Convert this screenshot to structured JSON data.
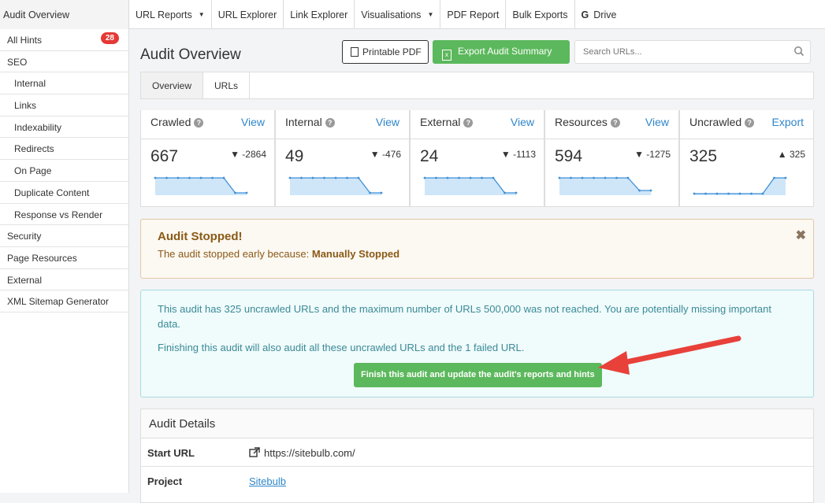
{
  "header": {
    "title": "Audit Overview",
    "menu": [
      {
        "label": "URL Reports",
        "dropdown": true
      },
      {
        "label": "URL Explorer",
        "dropdown": false
      },
      {
        "label": "Link Explorer",
        "dropdown": false
      },
      {
        "label": "Visualisations",
        "dropdown": true
      },
      {
        "label": "PDF Report",
        "dropdown": false
      },
      {
        "label": "Bulk Exports",
        "dropdown": false
      },
      {
        "label": "Drive",
        "dropdown": false,
        "icon": "google-g-icon"
      }
    ]
  },
  "sidebar": {
    "items": [
      {
        "label": "All Hints",
        "badge": "28",
        "sub": false
      },
      {
        "label": "SEO",
        "sub": false
      },
      {
        "label": "Internal",
        "sub": true
      },
      {
        "label": "Links",
        "sub": true
      },
      {
        "label": "Indexability",
        "sub": true
      },
      {
        "label": "Redirects",
        "sub": true
      },
      {
        "label": "On Page",
        "sub": true
      },
      {
        "label": "Duplicate Content",
        "sub": true
      },
      {
        "label": "Response vs Render",
        "sub": true
      },
      {
        "label": "Security",
        "sub": false
      },
      {
        "label": "Page Resources",
        "sub": false
      },
      {
        "label": "External",
        "sub": false
      },
      {
        "label": "XML Sitemap Generator",
        "sub": false
      }
    ]
  },
  "main": {
    "title": "Audit Overview",
    "printable_pdf": "Printable PDF",
    "export_summary": "Export Audit Summary",
    "search_placeholder": "Search URLs...",
    "tabs": [
      "Overview",
      "URLs"
    ],
    "cards": [
      {
        "title": "Crawled",
        "link": "View",
        "value": "667",
        "delta": "-2864",
        "direction": "down",
        "trend": [
          1,
          1,
          1,
          1,
          1,
          1,
          1,
          0.05,
          0.05
        ]
      },
      {
        "title": "Internal",
        "link": "View",
        "value": "49",
        "delta": "-476",
        "direction": "down",
        "trend": [
          1,
          1,
          1,
          1,
          1,
          1,
          1,
          0.05,
          0.05
        ]
      },
      {
        "title": "External",
        "link": "View",
        "value": "24",
        "delta": "-1113",
        "direction": "down",
        "trend": [
          1,
          1,
          1,
          1,
          1,
          1,
          1,
          0.05,
          0.05
        ]
      },
      {
        "title": "Resources",
        "link": "View",
        "value": "594",
        "delta": "-1275",
        "direction": "down",
        "trend": [
          1,
          1,
          1,
          1,
          1,
          1,
          1,
          0.2,
          0.2
        ]
      },
      {
        "title": "Uncrawled",
        "link": "Export",
        "value": "325",
        "delta": "325",
        "direction": "up",
        "trend": [
          0,
          0,
          0,
          0,
          0,
          0,
          0,
          1,
          1
        ]
      }
    ],
    "warning": {
      "title": "Audit Stopped!",
      "text": "The audit stopped early because: ",
      "reason": "Manually Stopped"
    },
    "info": {
      "line1": "This audit has 325 uncrawled URLs and the maximum number of URLs 500,000 was not reached. You are potentially missing important data.",
      "line2": "Finishing this audit will also audit all these uncrawled URLs and the 1 failed URL.",
      "button": "Finish this audit and update the audit's reports and hints"
    },
    "details": {
      "title": "Audit Details",
      "rows": [
        {
          "label": "Start URL",
          "value": "https://sitebulb.com/",
          "icon": "external-link-icon"
        },
        {
          "label": "Project",
          "value": "Sitebulb",
          "link": true
        }
      ]
    }
  },
  "colors": {
    "accent": "#5cb85c",
    "link": "#2f86c9",
    "badge": "#e53935",
    "spark_fill": "#cfe6f8",
    "spark_line": "#3d8fd6",
    "arrow": "#e8413a"
  }
}
